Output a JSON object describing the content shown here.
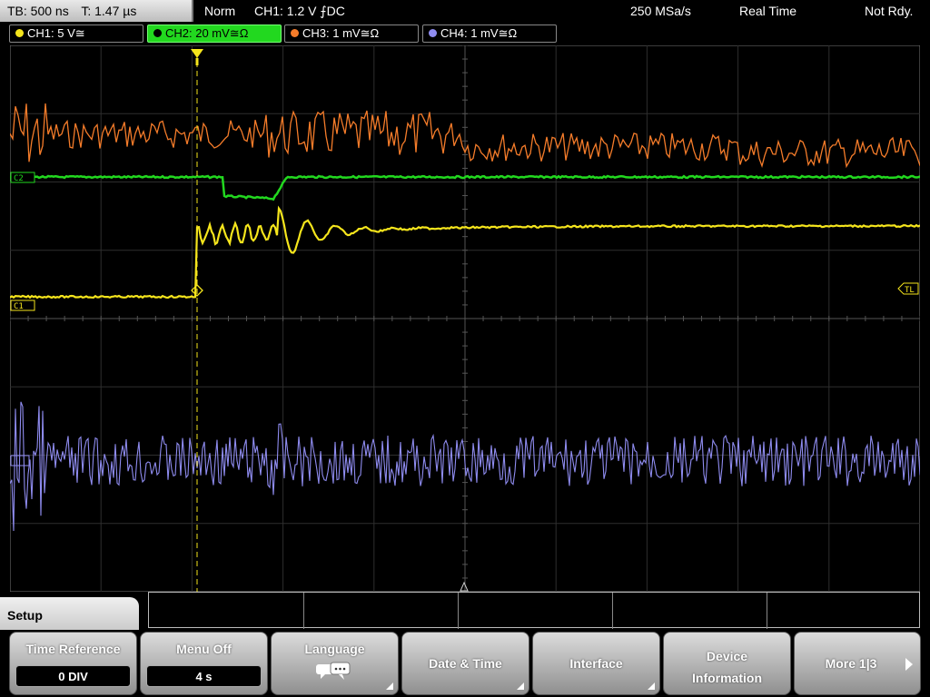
{
  "status": {
    "timebase": "TB: 500 ns",
    "trigger_time": "T: 1.47 µs",
    "mode": "Norm",
    "trigger_info": "CH1: 1.2 V ⨍DC",
    "sample_rate": "250 MSa/s",
    "acquisition": "Real Time",
    "state": "Not Rdy."
  },
  "channels": [
    {
      "label": "CH1: 5 V≅",
      "color": "#f5e51c"
    },
    {
      "label": "CH2: 20 mV≅Ω",
      "color": "#22d81f"
    },
    {
      "label": "CH3: 1 mV≅Ω",
      "color": "#f57c2a"
    },
    {
      "label": "CH4: 1 mV≅Ω",
      "color": "#8f8cf0"
    }
  ],
  "markers": {
    "ch1": "C1",
    "ch2": "C2",
    "trigger_level": "TL"
  },
  "menu": {
    "title": "Setup",
    "time_reference": {
      "label": "Time Reference",
      "value": "0 DIV"
    },
    "menu_off": {
      "label": "Menu Off",
      "value": "4 s"
    },
    "language": {
      "label": "Language",
      "icon": "speech-bubbles-icon"
    },
    "date_time": {
      "label": "Date & Time"
    },
    "interface": {
      "label": "Interface"
    },
    "device_info": {
      "label_line1": "Device",
      "label_line2": "Information"
    },
    "more": {
      "label": "More 1|3"
    }
  }
}
